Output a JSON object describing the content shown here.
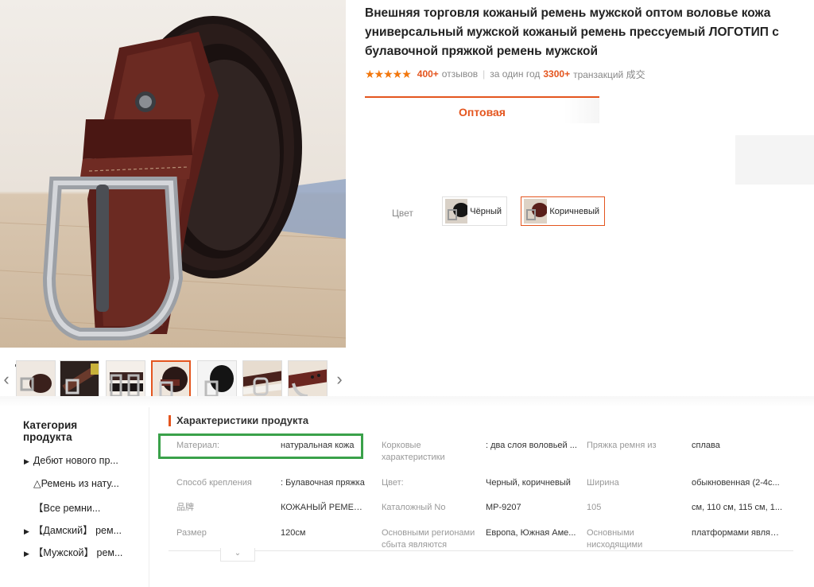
{
  "product": {
    "title": "Внешняя торговля кожаный ремень мужской оптом воловье кожа универсальный мужской кожаный ремень прессуемый ЛОГОТИП с булавочной пряжкой ремень мужской",
    "stars": "★★★★★",
    "reviews_count": "400+",
    "reviews_label": "отзывов",
    "sep": "|",
    "year_label": "за один год",
    "transactions_count": "3300+",
    "transactions_label": "транзакций 成交"
  },
  "tabs": {
    "wholesale": "Оптовая"
  },
  "color": {
    "label": "Цвет",
    "options": [
      {
        "name": "Чёрный",
        "selected": false
      },
      {
        "name": "Коричневый",
        "selected": true
      }
    ]
  },
  "gallery": {
    "prev": "‹",
    "next": "›",
    "thumb_count": 7,
    "active_index": 3
  },
  "sidebar": {
    "title": "Категория продукта",
    "categories": [
      {
        "tri": "▶",
        "label": "Дебют нового пр..."
      },
      {
        "tri": "",
        "label": "△Ремень из нату..."
      },
      {
        "tri": "",
        "label": "【Все ремни..."
      },
      {
        "tri": "▶",
        "label": "【Дамский】 рем..."
      },
      {
        "tri": "▶",
        "label": "【Мужской】 рем..."
      }
    ]
  },
  "specs": {
    "title": "Характеристики продукта",
    "rows": [
      [
        {
          "key": "Материал:",
          "value": "натуральная кожа"
        },
        {
          "key": "Корковые характеристики",
          "value": ": два слоя воловьей ..."
        },
        {
          "key": "Пряжка ремня из",
          "value": "сплава"
        }
      ],
      [
        {
          "key": "Способ крепления",
          "value": ": Булавочная пряжка"
        },
        {
          "key": "Цвет:",
          "value": "Черный, коричневый"
        },
        {
          "key": "Ширина",
          "value": "обыкновенная (2-4с..."
        }
      ],
      [
        {
          "key": "品牌",
          "value": "КОЖАНЫЙ РЕМЕНЬ ..."
        },
        {
          "key": "Каталожный No",
          "value": "MP-9207"
        },
        {
          "key": "105",
          "value": "см, 110 см, 115 см, 1..."
        }
      ],
      [
        {
          "key": "Размер",
          "value": "120см"
        },
        {
          "key": "Основными регионами сбыта являются",
          "value": "Европа, Южная Аме..."
        },
        {
          "key": "Основными нисходящими",
          "value": "платформами являю..."
        }
      ]
    ],
    "expand_icon": "⌄"
  },
  "colors": {
    "accent": "#e4551e",
    "highlight": "#3aa14a",
    "belt_brown": "#5a1f1a"
  }
}
